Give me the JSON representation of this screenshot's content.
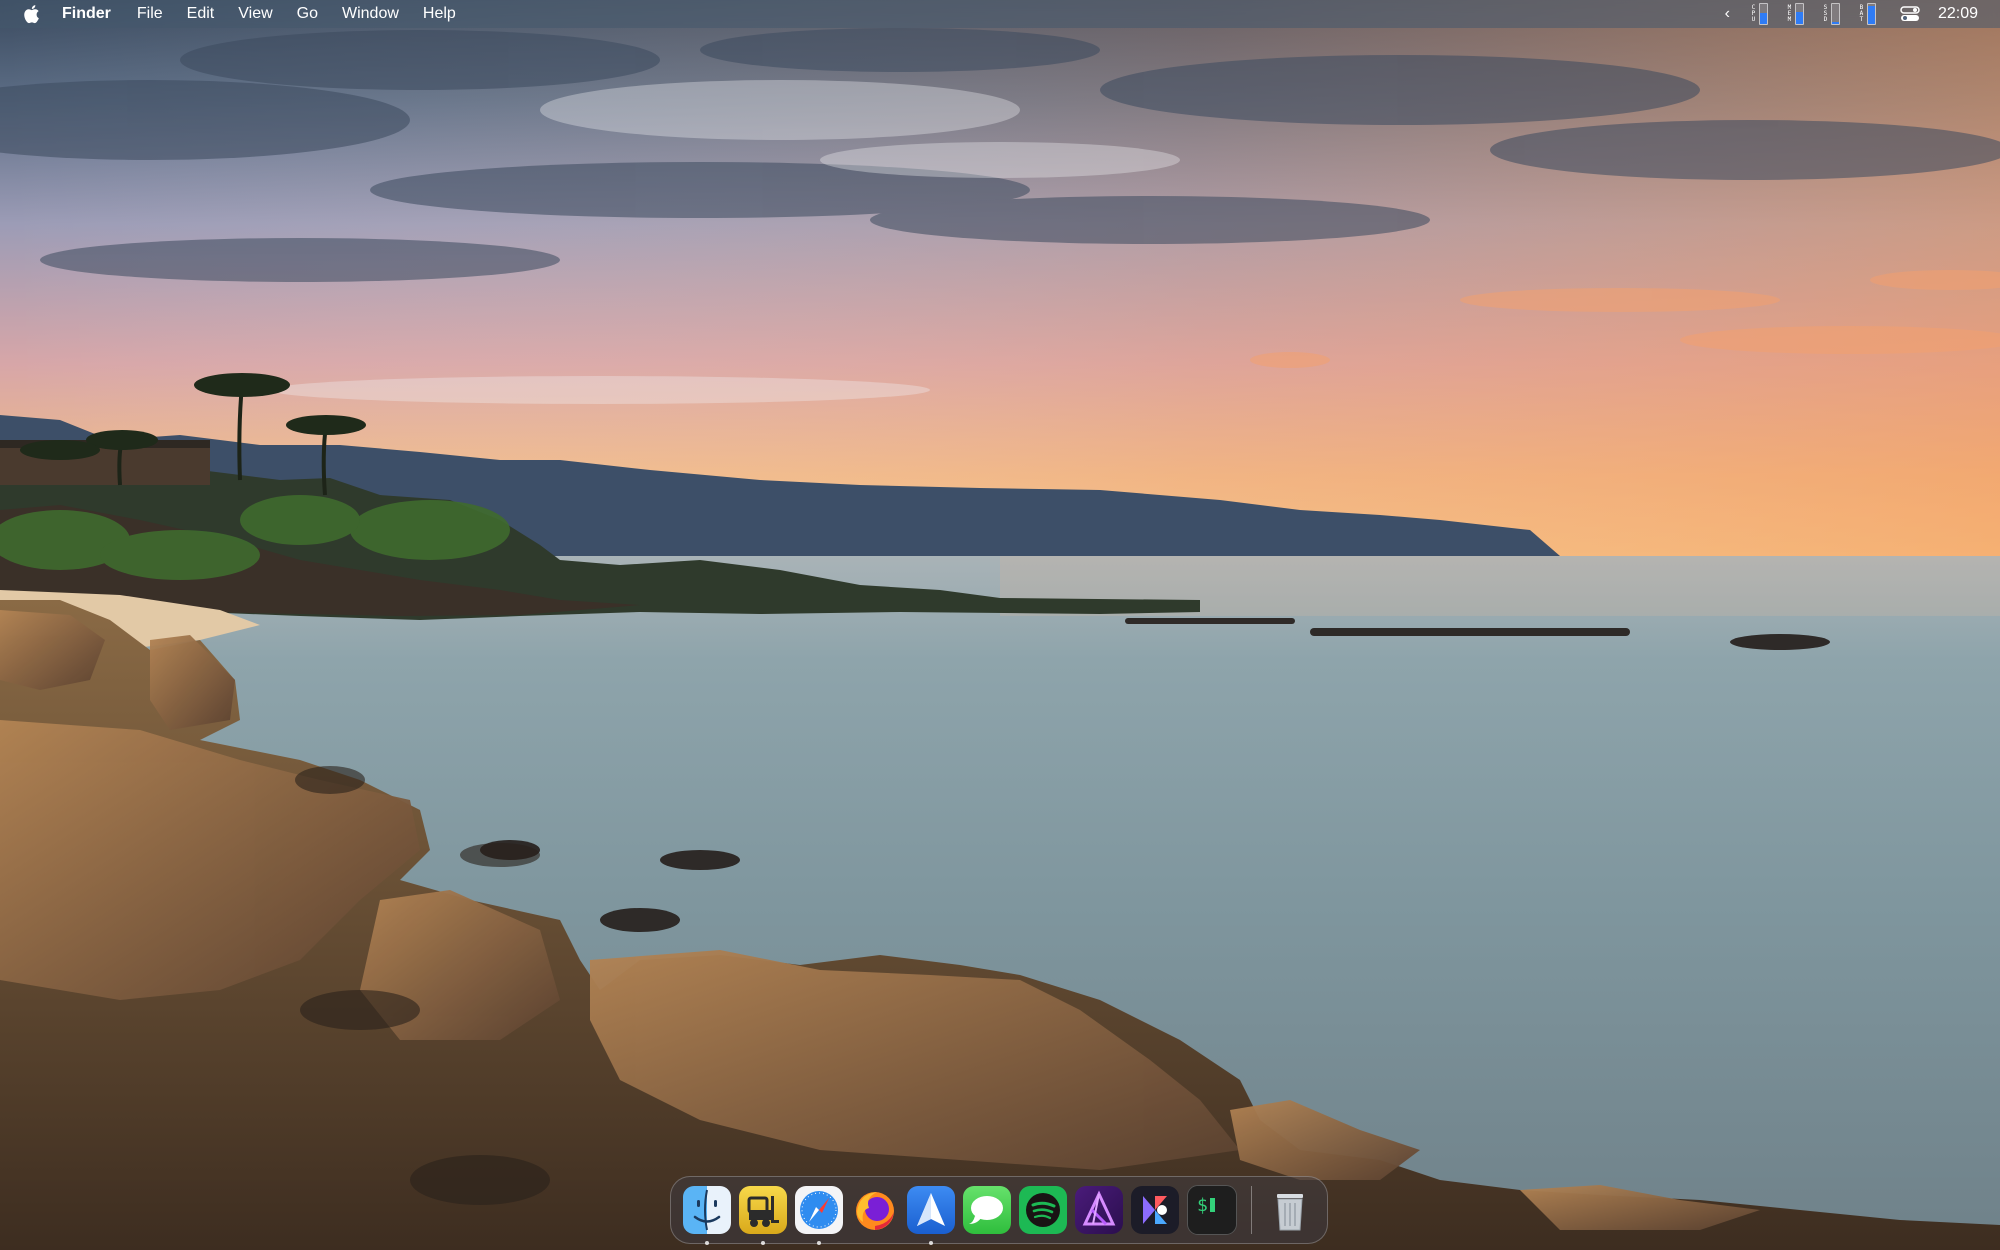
{
  "menubar": {
    "app_name": "Finder",
    "items": [
      "File",
      "Edit",
      "View",
      "Go",
      "Window",
      "Help"
    ],
    "status": {
      "chevron": "‹",
      "widgets": [
        {
          "name": "cpu",
          "label": "CPU",
          "level": 0.55
        },
        {
          "name": "mem",
          "label": "MEM",
          "level": 0.6
        },
        {
          "name": "ssd",
          "label": "SSD",
          "level": 0.1
        },
        {
          "name": "bat",
          "label": "BAT",
          "level": 0.9
        }
      ],
      "clock": "22:09"
    }
  },
  "dock": {
    "apps": [
      {
        "name": "finder",
        "icon": "finder-icon",
        "running": true
      },
      {
        "name": "forklift",
        "icon": "forklift-icon",
        "running": true
      },
      {
        "name": "safari",
        "icon": "safari-icon",
        "running": true
      },
      {
        "name": "firefox",
        "icon": "firefox-icon",
        "running": false
      },
      {
        "name": "spark",
        "icon": "paper-plane-icon",
        "running": true
      },
      {
        "name": "messages",
        "icon": "messages-icon",
        "running": false
      },
      {
        "name": "spotify",
        "icon": "spotify-icon",
        "running": false
      },
      {
        "name": "affinity-photo",
        "icon": "affinity-photo-icon",
        "running": false
      },
      {
        "name": "craft",
        "icon": "craft-icon",
        "running": false
      },
      {
        "name": "terminal",
        "icon": "terminal-icon",
        "running": false
      }
    ],
    "trash": {
      "name": "trash",
      "icon": "trash-icon"
    }
  },
  "colors": {
    "accent": "#2f7cf6",
    "menubar_text": "#ffffff"
  }
}
